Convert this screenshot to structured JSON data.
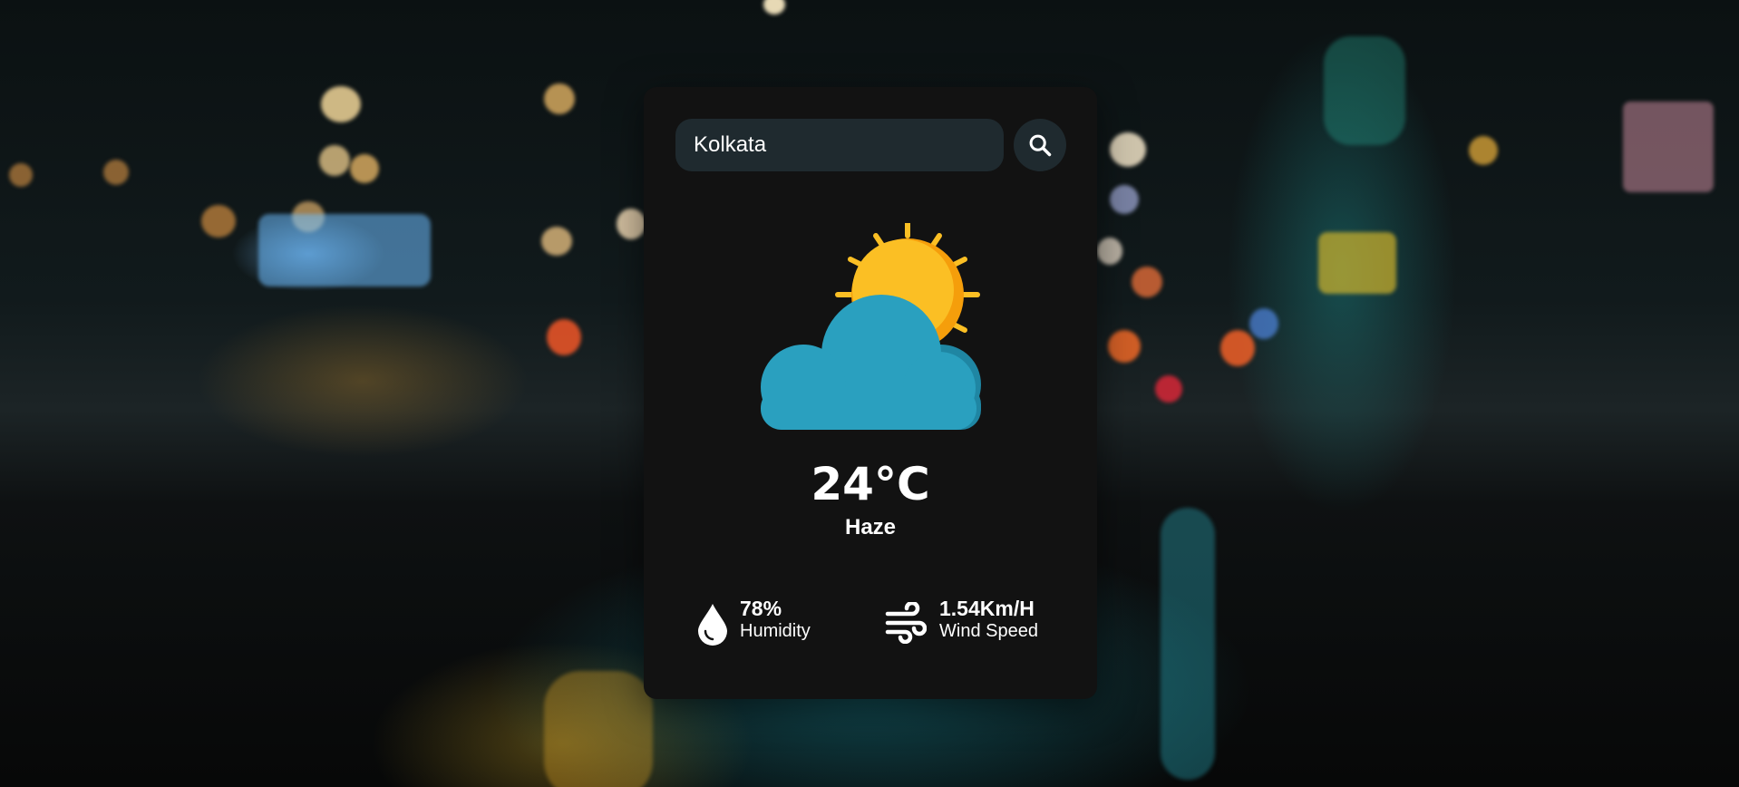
{
  "search": {
    "value": "Kolkata",
    "icon": "search-icon"
  },
  "weather": {
    "icon": "partly-cloudy-sun-icon",
    "temperature": "24°C",
    "condition": "Haze"
  },
  "details": {
    "humidity": {
      "value": "78%",
      "label": "Humidity",
      "icon": "water-drop-icon"
    },
    "wind": {
      "value": "1.54Km/H",
      "label": "Wind Speed",
      "icon": "wind-icon"
    }
  },
  "colors": {
    "card_background": "#121212",
    "input_background": "#1f2a2f",
    "sun": "#fbbf24",
    "cloud": "#2aa0bf",
    "text": "#ffffff"
  }
}
